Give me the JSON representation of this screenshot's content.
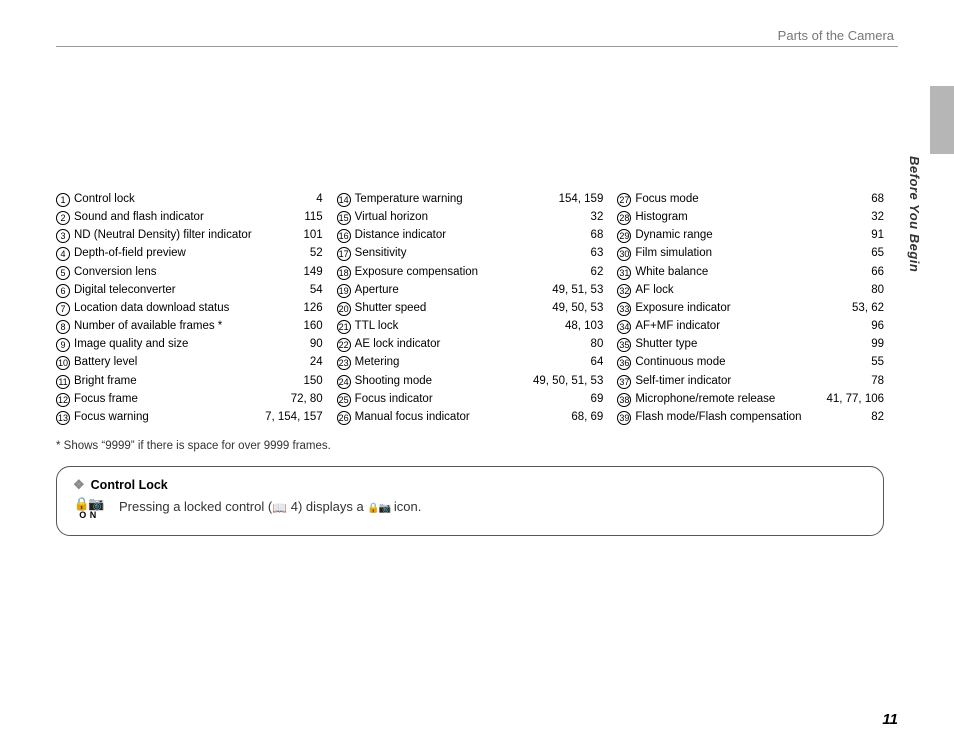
{
  "header": {
    "section_title": "Parts of the Camera",
    "tab_label": "Before You Begin",
    "page_number": "11"
  },
  "columns": [
    [
      {
        "n": "1",
        "label": "Control lock",
        "pages": "4"
      },
      {
        "n": "2",
        "label": "Sound and flash indicator",
        "pages": "115"
      },
      {
        "n": "3",
        "label": "ND (Neutral Density) filter indicator",
        "pages": "101"
      },
      {
        "n": "4",
        "label": "Depth-of-field preview",
        "pages": "52"
      },
      {
        "n": "5",
        "label": "Conversion lens",
        "pages": "149"
      },
      {
        "n": "6",
        "label": "Digital teleconverter",
        "pages": "54"
      },
      {
        "n": "7",
        "label": "Location data download status",
        "pages": "126"
      },
      {
        "n": "8",
        "label": "Number of available frames *",
        "pages": "160"
      },
      {
        "n": "9",
        "label": "Image quality and size",
        "pages": "90"
      },
      {
        "n": "10",
        "label": "Battery level",
        "pages": "24"
      },
      {
        "n": "11",
        "label": "Bright frame",
        "pages": "150"
      },
      {
        "n": "12",
        "label": "Focus frame",
        "pages": "72, 80"
      },
      {
        "n": "13",
        "label": "Focus warning",
        "pages": "7, 154, 157"
      }
    ],
    [
      {
        "n": "14",
        "label": "Temperature warning",
        "pages": "154, 159"
      },
      {
        "n": "15",
        "label": "Virtual horizon",
        "pages": "32"
      },
      {
        "n": "16",
        "label": "Distance indicator",
        "pages": "68"
      },
      {
        "n": "17",
        "label": "Sensitivity",
        "pages": "63"
      },
      {
        "n": "18",
        "label": "Exposure compensation",
        "pages": "62"
      },
      {
        "n": "19",
        "label": "Aperture",
        "pages": "49, 51, 53"
      },
      {
        "n": "20",
        "label": "Shutter speed",
        "pages": "49, 50, 53"
      },
      {
        "n": "21",
        "label": "TTL lock",
        "pages": "48, 103"
      },
      {
        "n": "22",
        "label": "AE lock indicator",
        "pages": "80"
      },
      {
        "n": "23",
        "label": "Metering",
        "pages": "64"
      },
      {
        "n": "24",
        "label": "Shooting mode",
        "pages": "49, 50, 51, 53"
      },
      {
        "n": "25",
        "label": "Focus indicator",
        "pages": "69"
      },
      {
        "n": "26",
        "label": "Manual focus indicator",
        "pages": "68, 69"
      }
    ],
    [
      {
        "n": "27",
        "label": "Focus mode",
        "pages": "68"
      },
      {
        "n": "28",
        "label": "Histogram",
        "pages": "32"
      },
      {
        "n": "29",
        "label": "Dynamic range",
        "pages": "91"
      },
      {
        "n": "30",
        "label": "Film simulation",
        "pages": "65"
      },
      {
        "n": "31",
        "label": "White balance",
        "pages": "66"
      },
      {
        "n": "32",
        "label": "AF lock",
        "pages": "80"
      },
      {
        "n": "33",
        "label": "Exposure indicator",
        "pages": "53, 62"
      },
      {
        "n": "34",
        "label": "AF+MF indicator",
        "pages": "96"
      },
      {
        "n": "35",
        "label": "Shutter type",
        "pages": "99"
      },
      {
        "n": "36",
        "label": "Continuous mode",
        "pages": "55"
      },
      {
        "n": "37",
        "label": "Self-timer indicator",
        "pages": "78"
      },
      {
        "n": "38",
        "label": "Microphone/remote release",
        "pages": "41, 77, 106"
      },
      {
        "n": "39",
        "label": "Flash mode/Flash compensation",
        "pages": "82"
      }
    ]
  ],
  "footnote": "*  Shows “9999” if there is space for over 9999 frames.",
  "callout": {
    "title": "Control Lock",
    "icon_on_label": "O N",
    "text_pre": "Pressing a locked control (",
    "text_ref": " 4) displays a ",
    "text_post": " icon."
  }
}
